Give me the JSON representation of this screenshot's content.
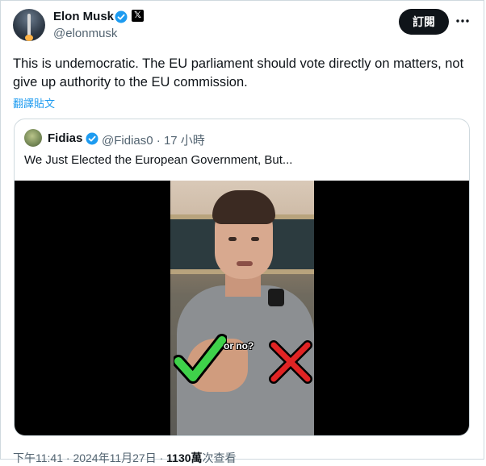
{
  "author": {
    "name": "Elon Musk",
    "handle": "@elonmusk",
    "affiliate_badge": "𝕏"
  },
  "actions": {
    "subscribe_label": "訂閱"
  },
  "tweet": {
    "text": "This is undemocratic. The EU parliament should vote directly on matters, not give up authority to the EU commission.",
    "translate_label": "翻譯貼文"
  },
  "quote": {
    "name": "Fidias",
    "handle": "@Fidias0",
    "separator": "·",
    "time": "17 小時",
    "text": "We Just Elected the European Government, But...",
    "video_caption": "or no?"
  },
  "footer": {
    "time": "下午11:41",
    "dot1": "·",
    "date": "2024年11月27日",
    "dot2": "·",
    "views_count": "1130萬",
    "views_label": "次查看"
  },
  "colors": {
    "accent": "#1d9bf0",
    "text": "#0f1419",
    "secondary": "#536471",
    "border": "#cfd9de"
  },
  "icons": [
    "verified-badge-icon",
    "x-logo-icon",
    "more-options-icon",
    "check-mark-icon",
    "cross-mark-icon"
  ]
}
